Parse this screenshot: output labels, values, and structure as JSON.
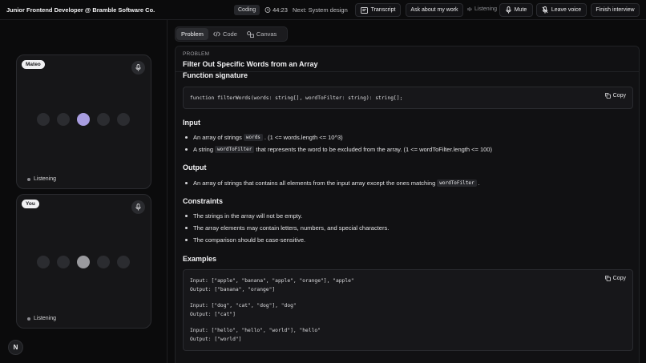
{
  "header": {
    "title": "Junior Frontend Developer @ Bramble Software Co.",
    "stage_badge": "Coding",
    "timer": "44:23",
    "next": "Next: System design",
    "transcript_label": "Transcript",
    "ask_label": "Ask about my work",
    "listening_label": "Listening",
    "mute_label": "Mute",
    "leave_voice_label": "Leave voice",
    "finish_label": "Finish interview"
  },
  "participants": [
    {
      "name": "Mateo",
      "status": "Listening",
      "active_dot_color": "#a89de0"
    },
    {
      "name": "You",
      "status": "Listening",
      "active_dot_color": "#9a9a9e"
    }
  ],
  "logo_letter": "N",
  "tabs": [
    {
      "label": "Problem",
      "active": true
    },
    {
      "label": "Code",
      "active": false
    },
    {
      "label": "Canvas",
      "active": false
    }
  ],
  "problem": {
    "label": "PROBLEM",
    "title": "Filter Out Specific Words from an Array",
    "signature_heading": "Function signature",
    "signature_code": "function filterWords(words: string[], wordToFilter: string): string[];",
    "copy_label": "Copy",
    "input_heading": "Input",
    "input_items": [
      {
        "pre": "An array of strings",
        "code": "words",
        "post": ". (1 <= words.length <= 10^3)"
      },
      {
        "pre": "A string",
        "code": "wordToFilter",
        "post": "that represents the word to be excluded from the array. (1 <= wordToFilter.length <= 100)"
      }
    ],
    "output_heading": "Output",
    "output_item": {
      "pre": "An array of strings that contains all elements from the input array except the ones matching",
      "code": "wordToFilter",
      "post": "."
    },
    "constraints_heading": "Constraints",
    "constraints": [
      "The strings in the array will not be empty.",
      "The array elements may contain letters, numbers, and special characters.",
      "The comparison should be case-sensitive."
    ],
    "examples_heading": "Examples",
    "examples": [
      "Input: [\"apple\", \"banana\", \"apple\", \"orange\"], \"apple\"",
      "Output: [\"banana\", \"orange\"]",
      "Input: [\"dog\", \"cat\", \"dog\"], \"dog\"",
      "Output: [\"cat\"]",
      "Input: [\"hello\", \"hello\", \"world\"], \"hello\"",
      "Output: [\"world\"]"
    ]
  }
}
